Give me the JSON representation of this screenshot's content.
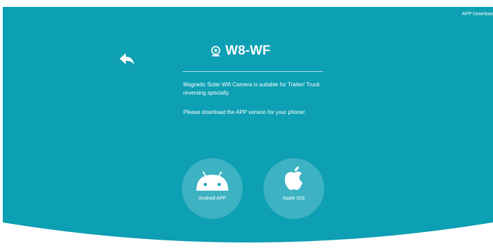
{
  "header": {
    "app_download_label": "APP Download",
    "title": "W8-WF",
    "camera_icon": "webcam-icon",
    "back_icon": "back-arrow-icon"
  },
  "content": {
    "description": "Magnetic Solar Wifi Camera is suitable for Trailer/ Truck reversing specially.",
    "instruction": "Please download the APP version for your phone!"
  },
  "downloads": [
    {
      "label": "Android APP",
      "icon": "android-icon"
    },
    {
      "label": "Apple IOS",
      "icon": "apple-icon"
    }
  ],
  "colors": {
    "background": "#0d9fb3",
    "text": "#ffffff",
    "page": "#ffffff"
  }
}
